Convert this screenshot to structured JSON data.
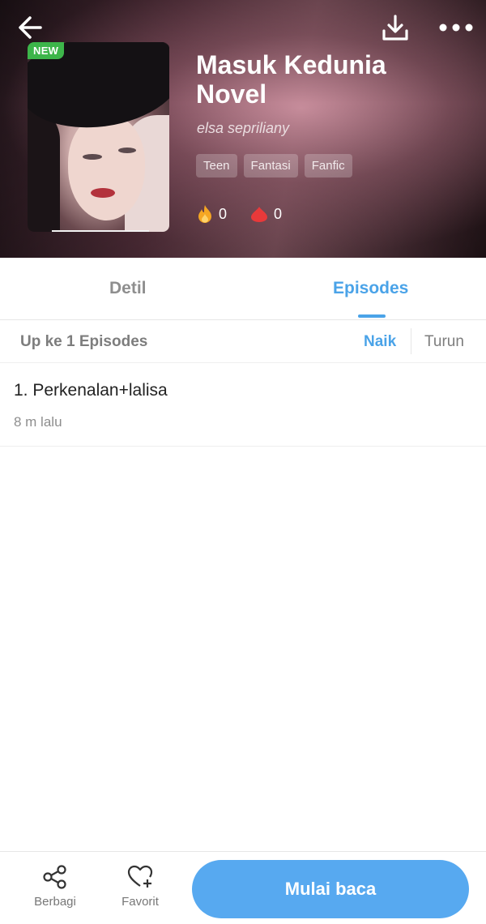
{
  "header": {
    "badge": "NEW",
    "title": "Masuk Kedunia Novel",
    "author": "elsa sepriliany",
    "tags": [
      "Teen",
      "Fantasi",
      "Fanfic"
    ],
    "stats": {
      "fire_count": "0",
      "drop_count": "0"
    }
  },
  "icons": {
    "back": "back-arrow-icon",
    "download": "download-icon",
    "more": "more-icon",
    "fire": "fire-icon",
    "drop": "drop-icon",
    "share": "share-icon",
    "favorite": "heart-plus-icon"
  },
  "tabs": [
    {
      "label": "Detil",
      "active": false
    },
    {
      "label": "Episodes",
      "active": true
    }
  ],
  "episodes_header": {
    "count_text": "Up ke 1 Episodes",
    "sort_asc": "Naik",
    "sort_desc": "Turun"
  },
  "episodes": [
    {
      "title": "1. Perkenalan+lalisa",
      "time": "8 m lalu"
    }
  ],
  "bottom_bar": {
    "share_label": "Berbagi",
    "favorite_label": "Favorit",
    "start_label": "Mulai baca"
  },
  "colors": {
    "accent": "#4aa3e8",
    "button": "#57a9f0",
    "badge": "#3db54a"
  }
}
